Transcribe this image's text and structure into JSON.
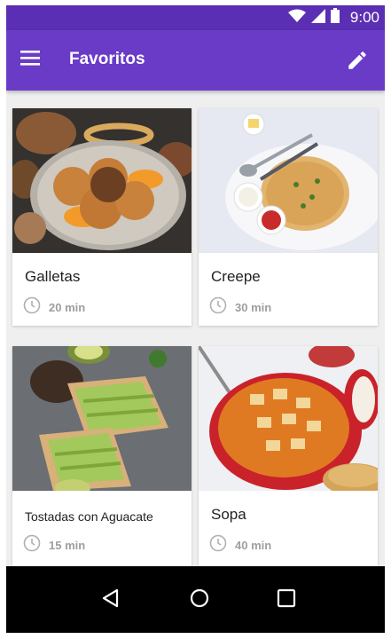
{
  "status_bar": {
    "time": "9:00"
  },
  "app_bar": {
    "title": "Favoritos",
    "menu_icon": "hamburger-menu-icon",
    "edit_icon": "pencil-icon"
  },
  "colors": {
    "primary": "#6a3bc7",
    "primary_dark": "#5b2fb3",
    "background": "#efefef"
  },
  "recipes": [
    {
      "name": "Galletas",
      "time": "20 min"
    },
    {
      "name": "Creepe",
      "time": "30 min"
    },
    {
      "name": "Tostadas con Aguacate",
      "time": "15 min"
    },
    {
      "name": "Sopa",
      "time": "40 min"
    }
  ],
  "nav": {
    "back_icon": "back-triangle-icon",
    "home_icon": "home-circle-icon",
    "recents_icon": "recents-square-icon"
  }
}
